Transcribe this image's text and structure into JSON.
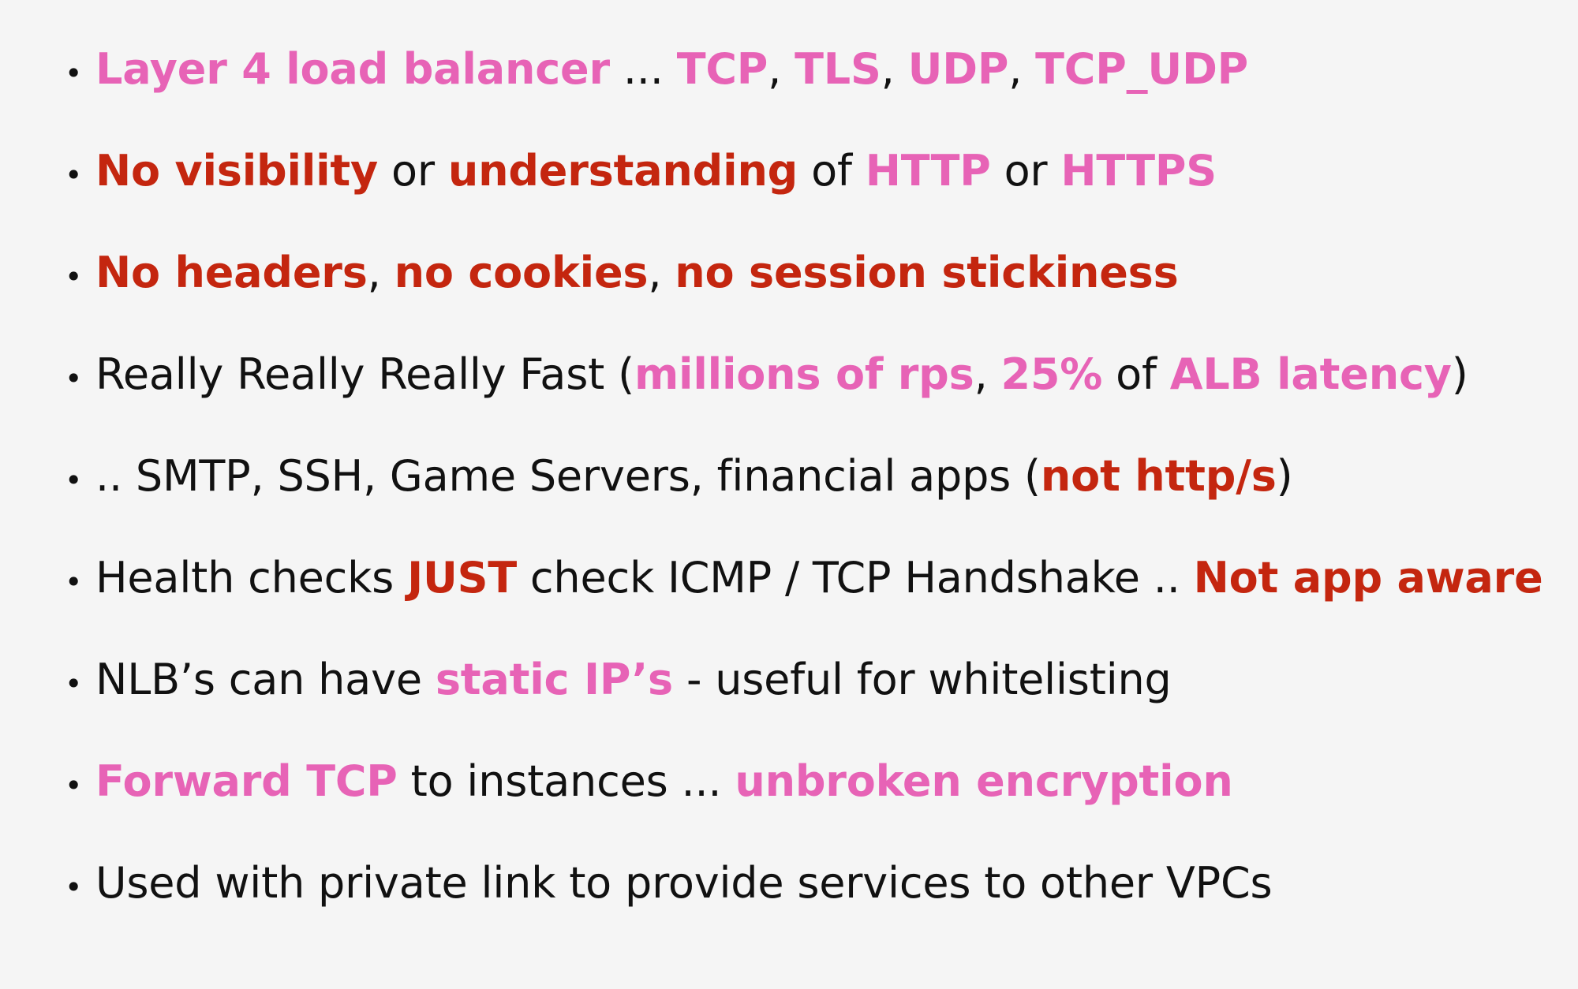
{
  "colors": {
    "background": "#f5f5f5",
    "text": "#111111",
    "highlight_pink": "#e763b6",
    "highlight_red": "#c4260f"
  },
  "bullet_symbol": "•",
  "bullets": [
    {
      "segments": [
        {
          "text": "Layer 4 load balancer",
          "style": "pink"
        },
        {
          "text": " ... ",
          "style": "plain"
        },
        {
          "text": "TCP",
          "style": "pink"
        },
        {
          "text": ", ",
          "style": "plain"
        },
        {
          "text": "TLS",
          "style": "pink"
        },
        {
          "text": ", ",
          "style": "plain"
        },
        {
          "text": "UDP",
          "style": "pink"
        },
        {
          "text": ", ",
          "style": "plain"
        },
        {
          "text": "TCP_UDP",
          "style": "pink"
        }
      ]
    },
    {
      "segments": [
        {
          "text": "No visibility",
          "style": "red"
        },
        {
          "text": " or ",
          "style": "plain"
        },
        {
          "text": "understanding",
          "style": "red"
        },
        {
          "text": " of ",
          "style": "plain"
        },
        {
          "text": "HTTP",
          "style": "pink"
        },
        {
          "text": " or ",
          "style": "plain"
        },
        {
          "text": "HTTPS",
          "style": "pink"
        }
      ]
    },
    {
      "segments": [
        {
          "text": "No headers",
          "style": "red"
        },
        {
          "text": ", ",
          "style": "plain"
        },
        {
          "text": "no cookies",
          "style": "red"
        },
        {
          "text": ", ",
          "style": "plain"
        },
        {
          "text": "no session stickiness",
          "style": "red"
        }
      ]
    },
    {
      "segments": [
        {
          "text": "Really Really Really Fast (",
          "style": "plain"
        },
        {
          "text": "millions of rps",
          "style": "pink"
        },
        {
          "text": ", ",
          "style": "plain"
        },
        {
          "text": "25%",
          "style": "pink"
        },
        {
          "text": " of ",
          "style": "plain"
        },
        {
          "text": "ALB latency",
          "style": "pink"
        },
        {
          "text": ")",
          "style": "plain"
        }
      ]
    },
    {
      "segments": [
        {
          "text": ".. SMTP, SSH, Game Servers, financial apps (",
          "style": "plain"
        },
        {
          "text": "not http/s",
          "style": "red"
        },
        {
          "text": ")",
          "style": "plain"
        }
      ]
    },
    {
      "segments": [
        {
          "text": "Health checks ",
          "style": "plain"
        },
        {
          "text": "JUST",
          "style": "red"
        },
        {
          "text": " check ICMP / TCP Handshake .. ",
          "style": "plain"
        },
        {
          "text": "Not app aware",
          "style": "red"
        }
      ]
    },
    {
      "segments": [
        {
          "text": "NLB’s can have ",
          "style": "plain"
        },
        {
          "text": "static IP’s",
          "style": "pink"
        },
        {
          "text": " - useful for whitelisting",
          "style": "plain"
        }
      ]
    },
    {
      "segments": [
        {
          "text": "Forward TCP",
          "style": "pink"
        },
        {
          "text": " to instances ... ",
          "style": "plain"
        },
        {
          "text": "unbroken encryption",
          "style": "pink"
        }
      ]
    },
    {
      "segments": [
        {
          "text": "Used with private link to provide services to other VPCs",
          "style": "plain"
        }
      ]
    }
  ]
}
